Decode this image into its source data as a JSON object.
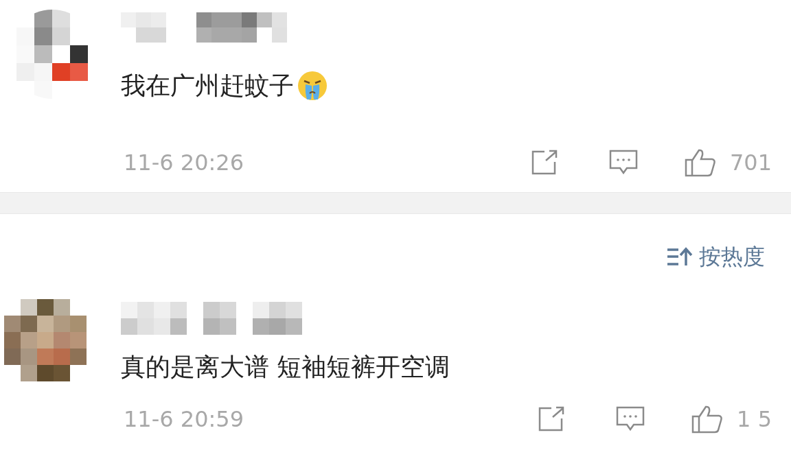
{
  "comments": [
    {
      "text": "我在广州赶蚊子",
      "emoji": true,
      "time": "11-6 20:26",
      "likes": "701"
    },
    {
      "text": "真的是离大谱 短袖短裤开空调",
      "emoji": false,
      "time": "11-6 20:59",
      "likes": "1 5"
    }
  ],
  "sort": {
    "label": "按热度"
  }
}
